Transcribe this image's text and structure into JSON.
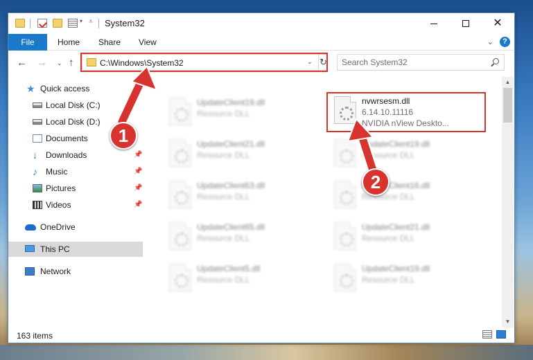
{
  "window": {
    "title": "System32",
    "controls": {
      "minimize": "",
      "maximize": "",
      "close": "✕"
    }
  },
  "ribbon": {
    "tabs": [
      "File",
      "Home",
      "Share",
      "View"
    ],
    "help": "?"
  },
  "address": {
    "path": "C:\\Windows\\System32",
    "search_placeholder": "Search System32"
  },
  "nav_pane": {
    "items": [
      {
        "label": "Quick access",
        "icon": "star-icon",
        "pinned": false
      },
      {
        "label": "Local Disk (C:)",
        "icon": "disk-icon",
        "pinned": false
      },
      {
        "label": "Local Disk (D:)",
        "icon": "disk-icon",
        "pinned": false
      },
      {
        "label": "Documents",
        "icon": "documents-icon",
        "pinned": false
      },
      {
        "label": "Downloads",
        "icon": "download-icon",
        "pinned": true
      },
      {
        "label": "Music",
        "icon": "music-icon",
        "pinned": true
      },
      {
        "label": "Pictures",
        "icon": "pictures-icon",
        "pinned": true
      },
      {
        "label": "Videos",
        "icon": "videos-icon",
        "pinned": true
      },
      {
        "label": "OneDrive",
        "icon": "onedrive-icon",
        "pinned": false
      },
      {
        "label": "This PC",
        "icon": "pc-icon",
        "pinned": false,
        "selected": true
      },
      {
        "label": "Network",
        "icon": "network-icon",
        "pinned": false
      }
    ]
  },
  "files": {
    "highlighted": {
      "name": "nvwrsesm.dll",
      "version": "6.14.10.11116",
      "description": "NVIDIA nView Deskto..."
    },
    "left_column": [
      {
        "name": "UpdateClient19.dll",
        "type": "Resource DLL"
      },
      {
        "name": "UpdateClient21.dll",
        "type": "Resource DLL"
      },
      {
        "name": "UpdateClient63.dll",
        "type": "Resource DLL"
      },
      {
        "name": "UpdateClient65.dll",
        "type": "Resource DLL"
      },
      {
        "name": "UpdateClient5.dll",
        "type": "Resource DLL"
      }
    ],
    "right_column": [
      {
        "name": "UpdateClient19.dll",
        "type": "Resource DLL"
      },
      {
        "name": "UpdateClient16.dll",
        "type": "Resource DLL"
      },
      {
        "name": "UpdateClient21.dll",
        "type": "Resource DLL"
      },
      {
        "name": "UpdateClient19.dll",
        "type": "Resource DLL"
      }
    ]
  },
  "status": {
    "item_count": "163 items"
  },
  "annotations": {
    "step1": "1",
    "step2": "2",
    "color": "#d8342f"
  },
  "colors": {
    "accent": "#1979ca",
    "selection": "#d9d9d9"
  }
}
